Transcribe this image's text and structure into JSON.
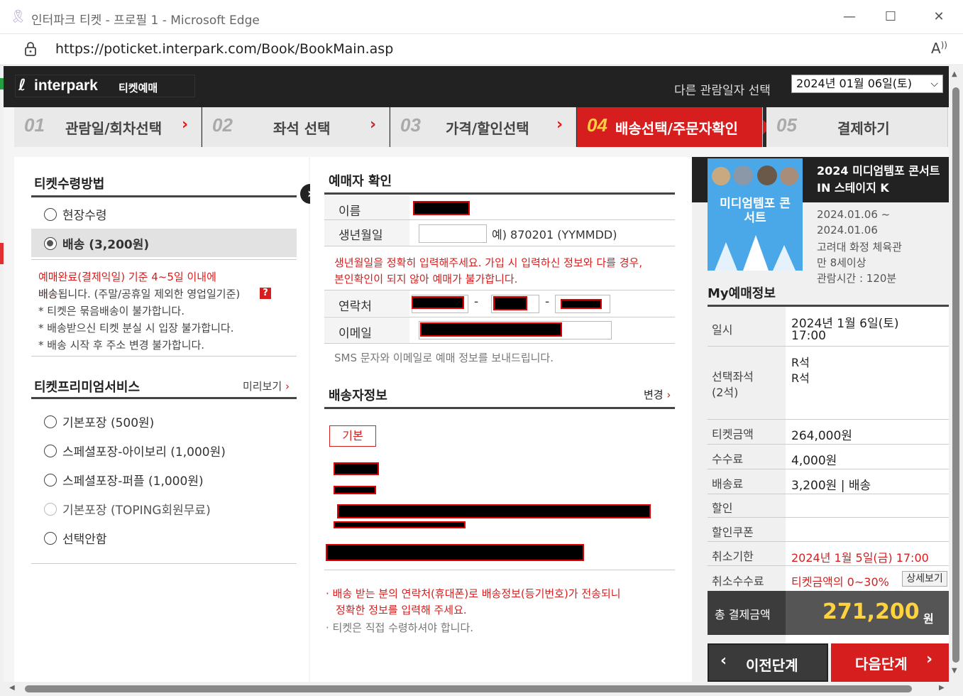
{
  "window": {
    "title": "인터파크 티켓 - 프로필 1 - Microsoft Edge",
    "url": "https://poticket.interpark.com/Book/BookMain.asp",
    "controls": [
      "—",
      "☐",
      "✕"
    ]
  },
  "header": {
    "logo_name": "interpark",
    "logo_sub": "티켓예매",
    "date_label": "다른 관람일자 선택",
    "date_value": "2024년 01월 06일(토)"
  },
  "steps": [
    {
      "num": "01",
      "label": "관람일/회차선택"
    },
    {
      "num": "02",
      "label": "좌석 선택"
    },
    {
      "num": "03",
      "label": "가격/할인선택"
    },
    {
      "num": "04",
      "label": "배송선택/주문자확인"
    },
    {
      "num": "05",
      "label": "결제하기"
    }
  ],
  "left": {
    "receive_title": "티켓수령방법",
    "receive_options": [
      {
        "label": "현장수령",
        "selected": false
      },
      {
        "label": "배송 (3,200원)",
        "selected": true
      }
    ],
    "delivery_notice_1": "예매완료(결제익일) 기준 4~5일 이내에",
    "delivery_notice_2": "배송됩니다. (주말/공휴일 제외한 영업일기준)",
    "help": "?",
    "notes": [
      "* 티켓은 묶음배송이 불가합니다.",
      "* 배송받으신 티켓 분실 시 입장 불가합니다.",
      "* 배송 시작 후 주소 변경 불가합니다."
    ],
    "premium_title": "티켓프리미엄서비스",
    "preview": "미리보기",
    "premium_options": [
      {
        "label": "기본포장 (500원)",
        "disabled": false
      },
      {
        "label": "스페셜포장-아이보리 (1,000원)",
        "disabled": false
      },
      {
        "label": "스페셜포장-퍼플 (1,000원)",
        "disabled": false
      },
      {
        "label": "기본포장 (TOPING회원무료)",
        "disabled": true
      },
      {
        "label": "선택안함",
        "disabled": false
      }
    ]
  },
  "mid": {
    "booker_title": "예매자 확인",
    "name_label": "이름",
    "birth_label": "생년월일",
    "birth_example": "예) 870201 (YYMMDD)",
    "birth_warning_1": "생년월일을 정확히 입력해주세요. 가입 시 입력하신 정보와 다를 경우,",
    "birth_warning_2": "본인확인이 되지 않아 예매가 불가합니다.",
    "phone_label": "연락처",
    "phone_sep": "-",
    "email_label": "이메일",
    "sms_note": "SMS 문자와 이메일로 예매 정보를 보내드립니다.",
    "shipping_title": "배송자정보",
    "change": "변경",
    "basic_tag": "기본",
    "foot_note_1": "· 배송 받는 분의 연락처(휴대폰)로 배송정보(등기번호)가 전송되니",
    "foot_note_2": "정확한 정보를 입력해 주세요.",
    "foot_note_3": "· 티켓은 직접 수령하셔야 합니다."
  },
  "right": {
    "poster_caption": "미디엄템포 콘서트",
    "show_title": "2024 미디엄템포 콘서트 IN 스테이지 K",
    "period_1": "2024.01.06 ~",
    "period_2": "2024.01.06",
    "venue": "고려대 화정 체육관",
    "age": "만 8세이상",
    "runtime": "관람시간 : 120분",
    "my_title": "My예매정보",
    "rows": {
      "date_label": "일시",
      "date_val_1": "2024년 1월 6일(토)",
      "date_val_2": "17:00",
      "seat_label_1": "선택좌석",
      "seat_label_2": "(2석)",
      "seat_1": "R석",
      "seat_2": "R석",
      "ticket_label": "티켓금액",
      "ticket_val": "264,000원",
      "fee_label": "수수료",
      "fee_val": "4,000원",
      "ship_label": "배송료",
      "ship_val": "3,200원 | 배송",
      "disc_label": "할인",
      "coupon_label": "할인쿠폰",
      "cancel_deadline_label": "취소기한",
      "cancel_deadline_val": "2024년 1월 5일(금) 17:00",
      "cancel_fee_label": "취소수수료",
      "cancel_fee_val": "티켓금액의 0~30%",
      "detail_btn": "상세보기"
    },
    "total_label": "총 결제금액",
    "total_val": "271,200",
    "total_unit": "원",
    "prev_btn": "이전단계",
    "next_btn": "다음단계"
  }
}
